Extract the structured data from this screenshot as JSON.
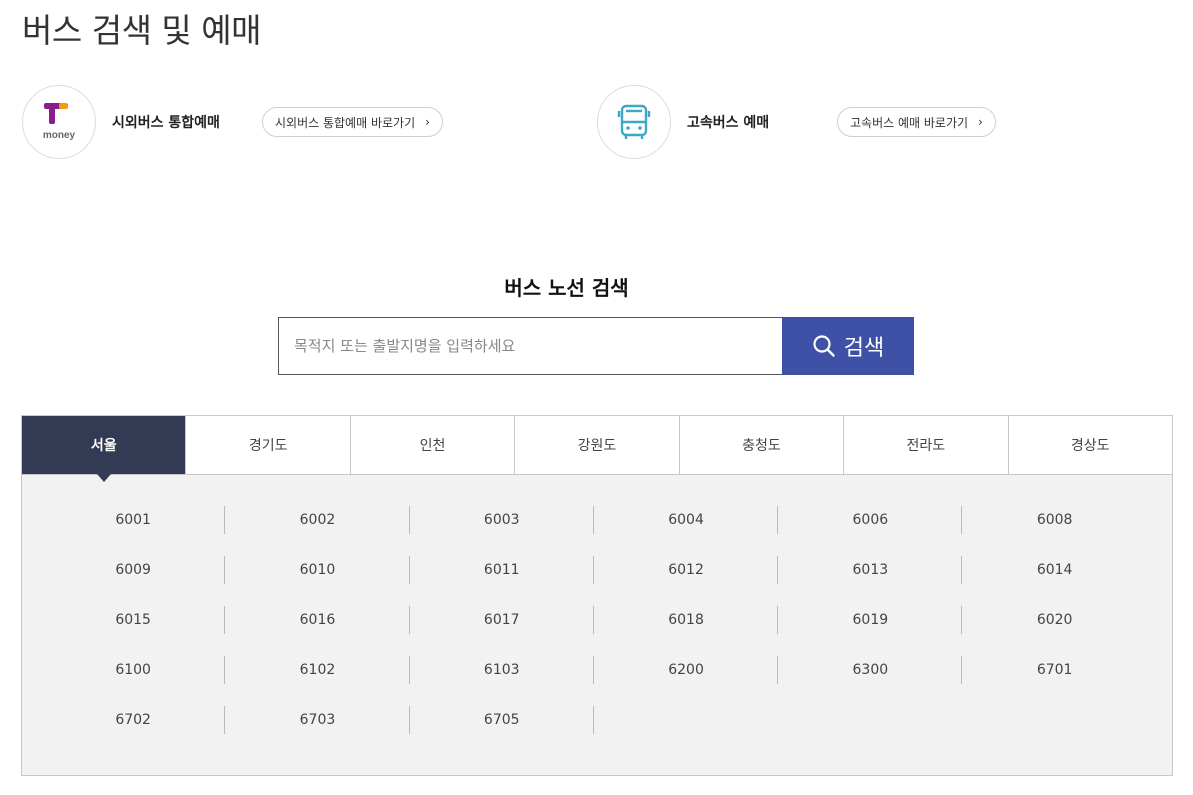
{
  "page_title": "버스 검색 및 예매",
  "services": {
    "city": {
      "logo_text": "money",
      "name": "시외버스 통합예매",
      "button_label": "시외버스 통합예매 바로가기",
      "chevron": "›"
    },
    "express": {
      "icon": "bus-icon",
      "name": "고속버스 예매",
      "button_label": "고속버스 예매 바로가기",
      "chevron": "›"
    }
  },
  "search": {
    "title": "버스 노선 검색",
    "placeholder": "목적지 또는 출발지명을 입력하세요",
    "button_label": "검색",
    "button_color": "#3f51a6"
  },
  "regions": {
    "active": "서울",
    "active_color": "#333a54",
    "tabs": [
      "서울",
      "경기도",
      "인천",
      "강원도",
      "충청도",
      "전라도",
      "경상도"
    ]
  },
  "routes": [
    "6001",
    "6002",
    "6003",
    "6004",
    "6006",
    "6008",
    "6009",
    "6010",
    "6011",
    "6012",
    "6013",
    "6014",
    "6015",
    "6016",
    "6017",
    "6018",
    "6019",
    "6020",
    "6100",
    "6102",
    "6103",
    "6200",
    "6300",
    "6701",
    "6702",
    "6703",
    "6705"
  ]
}
